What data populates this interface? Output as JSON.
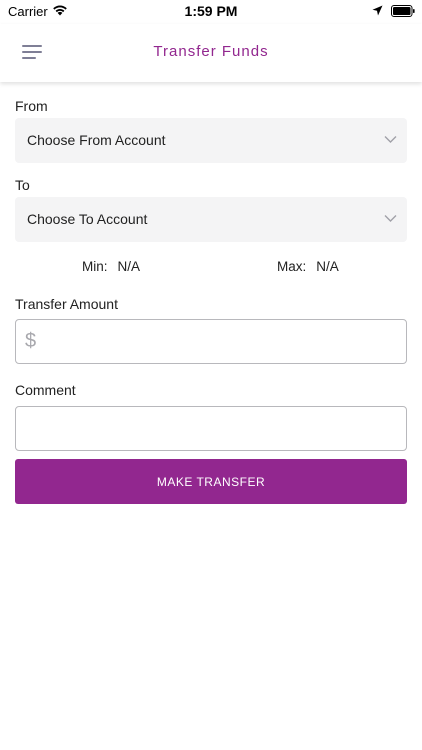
{
  "status_bar": {
    "carrier": "Carrier",
    "time": "1:59 PM",
    "icons": [
      "wifi-icon",
      "location-arrow-icon",
      "battery-icon"
    ]
  },
  "header": {
    "title": "Transfer Funds",
    "menu_icon": "hamburger-menu-icon"
  },
  "form": {
    "from_label": "From",
    "from_select": "Choose From Account",
    "to_label": "To",
    "to_select": "Choose To Account",
    "min_label": "Min:",
    "min_value": "N/A",
    "max_label": "Max:",
    "max_value": "N/A",
    "amount_label": "Transfer Amount",
    "amount_prefix": "$",
    "amount_value": "",
    "comment_label": "Comment",
    "comment_value": "",
    "submit_label": "MAKE TRANSFER"
  },
  "colors": {
    "brand": "#92278f",
    "select_bg": "#f4f4f5",
    "input_border": "#b8b8bc",
    "chevron": "#a0a0a8"
  }
}
